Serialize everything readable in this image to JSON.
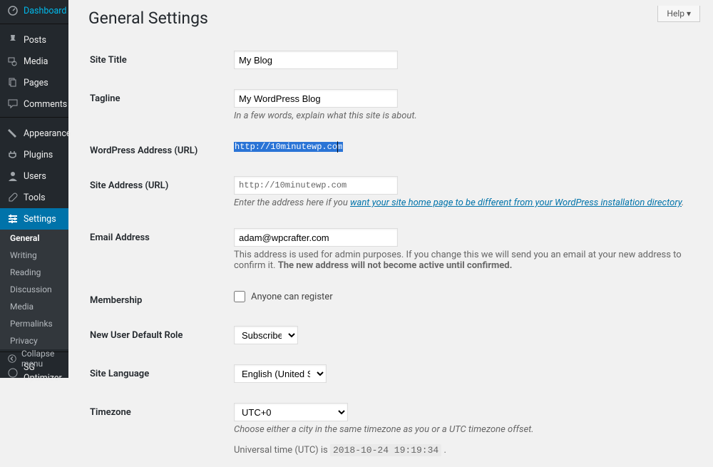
{
  "sidebar": {
    "items": [
      {
        "label": "Dashboard",
        "icon": "dashboard"
      },
      {
        "label": "Posts",
        "icon": "pin"
      },
      {
        "label": "Media",
        "icon": "media"
      },
      {
        "label": "Pages",
        "icon": "page"
      },
      {
        "label": "Comments",
        "icon": "comment"
      },
      {
        "label": "Appearance",
        "icon": "appearance"
      },
      {
        "label": "Plugins",
        "icon": "plug"
      },
      {
        "label": "Users",
        "icon": "user"
      },
      {
        "label": "Tools",
        "icon": "tools"
      },
      {
        "label": "Settings",
        "icon": "settings"
      },
      {
        "label": "SG Optimizer",
        "icon": "sg"
      }
    ],
    "submenu": [
      "General",
      "Writing",
      "Reading",
      "Discussion",
      "Media",
      "Permalinks",
      "Privacy"
    ],
    "collapse": "Collapse menu"
  },
  "help_label": "Help",
  "page_title": "General Settings",
  "fields": {
    "site_title": {
      "label": "Site Title",
      "value": "My Blog"
    },
    "tagline": {
      "label": "Tagline",
      "value": "My WordPress Blog",
      "desc": "In a few words, explain what this site is about."
    },
    "wp_address": {
      "label": "WordPress Address (URL)",
      "value": "http://10minutewp.com"
    },
    "site_address": {
      "label": "Site Address (URL)",
      "value": "http://10minutewp.com",
      "desc_pre": "Enter the address here if you ",
      "desc_link": "want your site home page to be different from your WordPress installation directory",
      "desc_post": "."
    },
    "email": {
      "label": "Email Address",
      "value": "adam@wpcrafter.com",
      "desc_plain": "This address is used for admin purposes. If you change this we will send you an email at your new address to confirm it. ",
      "desc_bold": "The new address will not become active until confirmed."
    },
    "membership": {
      "label": "Membership",
      "checkbox_label": "Anyone can register"
    },
    "default_role": {
      "label": "New User Default Role",
      "value": "Subscriber"
    },
    "site_language": {
      "label": "Site Language",
      "value": "English (United States)"
    },
    "timezone": {
      "label": "Timezone",
      "value": "UTC+0",
      "desc": "Choose either a city in the same timezone as you or a UTC timezone offset.",
      "utc_pre": "Universal time (UTC) is ",
      "utc_val": "2018-10-24 19:19:34",
      "utc_post": " ."
    }
  }
}
